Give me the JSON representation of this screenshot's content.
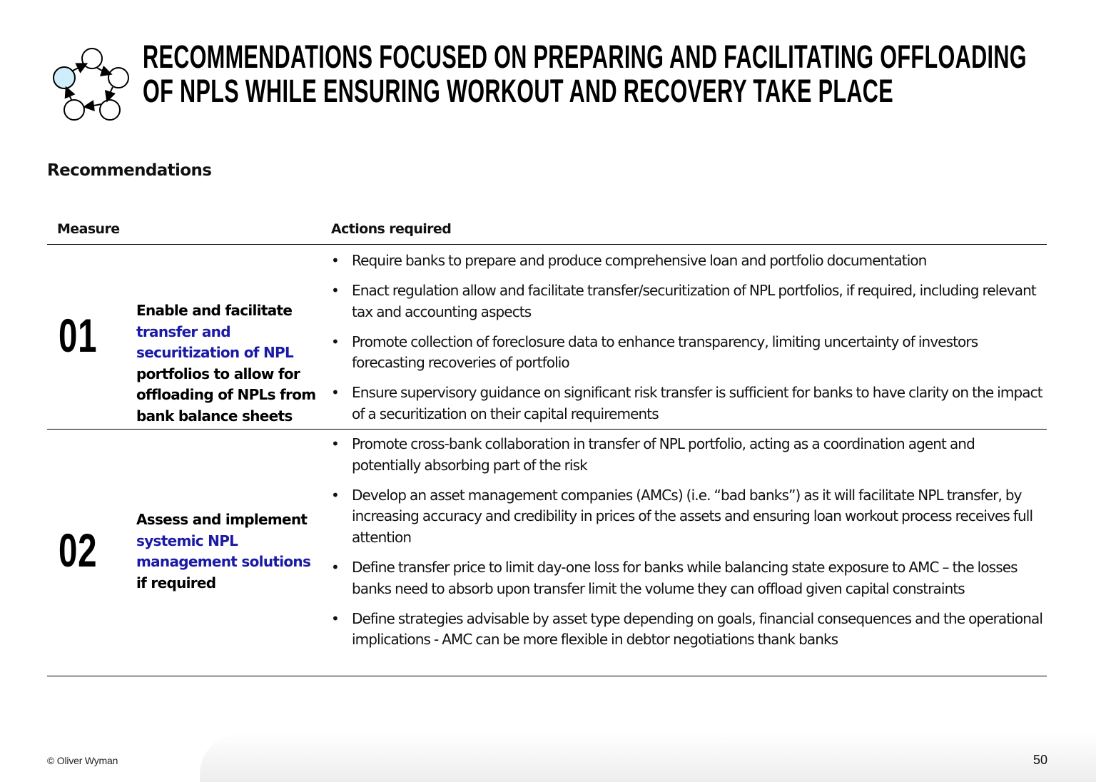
{
  "header": {
    "logo_icon": "cycle-circles-icon",
    "title_lines": [
      "RECOMMENDATIONS FOCUSED ON PREPARING AND FACILITATING OFFLOADING",
      "OF NPLS WHILE ENSURING WORKOUT AND RECOVERY TAKE PLACE"
    ]
  },
  "section_heading": "Recommendations",
  "table": {
    "headers": {
      "measure": "Measure",
      "actions": "Actions required"
    },
    "rows": [
      {
        "number": "01",
        "measure_parts": [
          {
            "text": "Enable and facilitate ",
            "highlight": false
          },
          {
            "text": "transfer and securitization of NPL",
            "highlight": true
          },
          {
            "text": " portfolios to allow for offloading of NPLs from bank balance sheets",
            "highlight": false
          }
        ],
        "actions": [
          "Require banks to prepare and produce comprehensive loan and portfolio documentation",
          "Enact regulation allow and facilitate transfer/securitization of NPL portfolios, if required, including relevant tax and accounting aspects",
          "Promote collection of foreclosure data to enhance transparency, limiting uncertainty of investors forecasting recoveries of portfolio",
          "Ensure supervisory guidance on significant risk transfer is sufficient for banks to have clarity on the impact of a securitization on their capital requirements"
        ]
      },
      {
        "number": "02",
        "measure_parts": [
          {
            "text": "Assess and implement ",
            "highlight": false
          },
          {
            "text": "systemic NPL management solutions",
            "highlight": true
          },
          {
            "text": " if required",
            "highlight": false
          }
        ],
        "actions": [
          "Promote cross-bank collaboration in transfer of NPL portfolio, acting as a coordination agent and potentially absorbing part of the risk",
          "Develop an asset management companies (AMCs) (i.e. “bad banks”) as it will facilitate NPL transfer, by increasing accuracy and credibility in prices of the assets and ensuring loan workout process receives full attention",
          "Define transfer price to limit day-one loss for banks while balancing state exposure to AMC – the losses banks need to absorb upon transfer limit the volume they can offload given capital constraints",
          "Define strategies advisable by asset type depending on goals, financial consequences and the operational implications - AMC can be more flexible in debtor negotiations thank banks"
        ]
      }
    ]
  },
  "footer": {
    "copyright": "© Oliver Wyman",
    "page_number": "50"
  },
  "colors": {
    "highlight_blue": "#1a1aa6",
    "logo_fill": "#cdeefa"
  }
}
